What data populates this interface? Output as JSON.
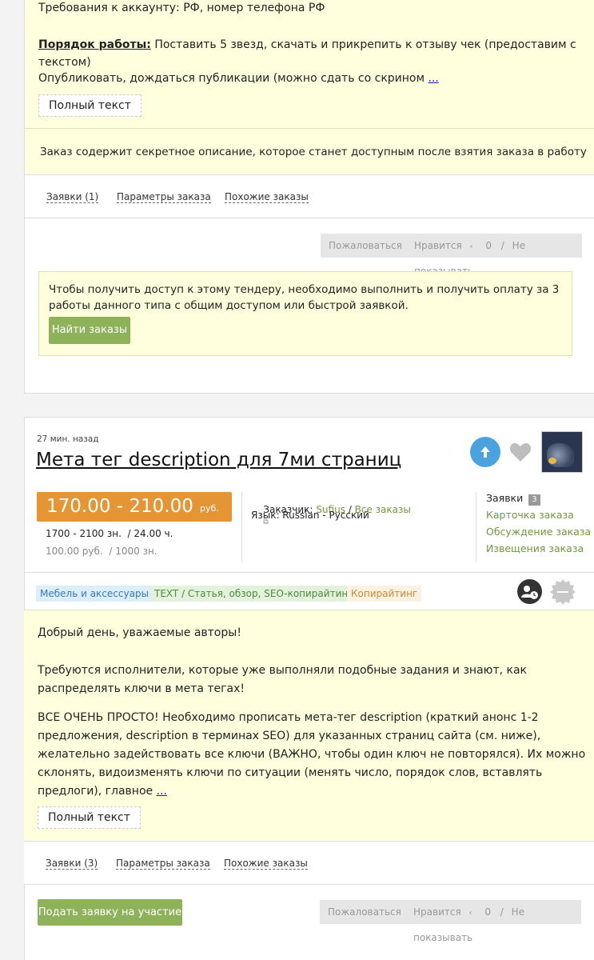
{
  "order1": {
    "requirements_line": "Требования к аккаунту: РФ, номер телефона РФ",
    "procedure_label": "Порядок работы:",
    "procedure_text": " Поставить 5 звезд, скачать и прикрепить к отзыву чек (предоставим с текстом)",
    "publish_text": "Опубликовать, дождаться публикации (можно сдать со скрином ",
    "more_link": "...",
    "full_text_button": "Полный текст",
    "secret_notice": "Заказ содержит секретное описание, которое станет доступным после взятия заказа в работу",
    "tabs": [
      "Заявки (1)",
      "Параметры заказа",
      "Похожие заказы"
    ],
    "complain_button": "Пожаловаться",
    "like_button": "Нравится",
    "like_count": "0",
    "separator": "/",
    "hide_button": "Не показывать",
    "access_notice": "Чтобы получить доступ к этому тендеру, необходимо выполнить и получить оплату за 3 работы данного типа с общим доступом или быстрой заявкой.",
    "find_orders_button": "Найти заказы"
  },
  "order2": {
    "time_ago": "27 мин. назад",
    "title": "Мета тег description для 7ми страниц",
    "price_range": "170.00 - 210.00",
    "price_currency": "руб.",
    "price_per_chars": "1700 - 2100 зн.  / 24.00 ч.",
    "price_rate": "100.00 руб.  / 1000 зн.",
    "customer_label": "Заказчик:",
    "customer_name": "Sufius",
    "customer_sep": " / ",
    "all_orders_link": "Все заказы",
    "language_line": "Язык: Russian - Русский",
    "bids_label": "Заявки",
    "bids_count": "3",
    "side_links": [
      "Карточка заказа",
      "Обсуждение заказа",
      "Извещения заказа"
    ],
    "tags": [
      "Мебель и аксессуары",
      "TEXT / Статья, обзор, SEO-копирайтинг",
      "Копирайтинг"
    ],
    "desc_p1": "Добрый день, уважаемые авторы!",
    "desc_p2": "Требуются исполнители, которые уже выполняли подобные задания и знают, как распределять ключи в мета тегах!",
    "desc_p3": "ВСЕ ОЧЕНЬ ПРОСТО! Необходимо прописать мета-тег description (краткий анонс 1-2 предложения, description в терминах SEO) для указанных страниц сайта (см. ниже), желательно задействовать все ключи (ВАЖНО, чтобы один ключ не повторялся). Их можно склонять, видоизменять ключи по ситуации (менять число, порядок слов, вставлять предлоги), главное ",
    "more_link": "...",
    "full_text_button": "Полный текст",
    "tabs": [
      "Заявки (3)",
      "Параметры заказа",
      "Похожие заказы"
    ],
    "apply_button": "Подать заявку на участие",
    "complain_button": "Пожаловаться",
    "like_button": "Нравится",
    "like_count": "0",
    "separator": "/",
    "hide_button": "Не показывать"
  },
  "colors": {
    "price_orange": "#e69535",
    "green": "#8db25a",
    "link_green": "#6d9a3e",
    "upvote_blue": "#4aa3df",
    "yellow_bg": "#ffffdd"
  },
  "icons": {
    "upvote": "arrow-up-icon",
    "favorite": "heart-icon",
    "external": "external-link-icon",
    "customer": "user-clock-icon",
    "badge": "gear-badge-icon"
  }
}
